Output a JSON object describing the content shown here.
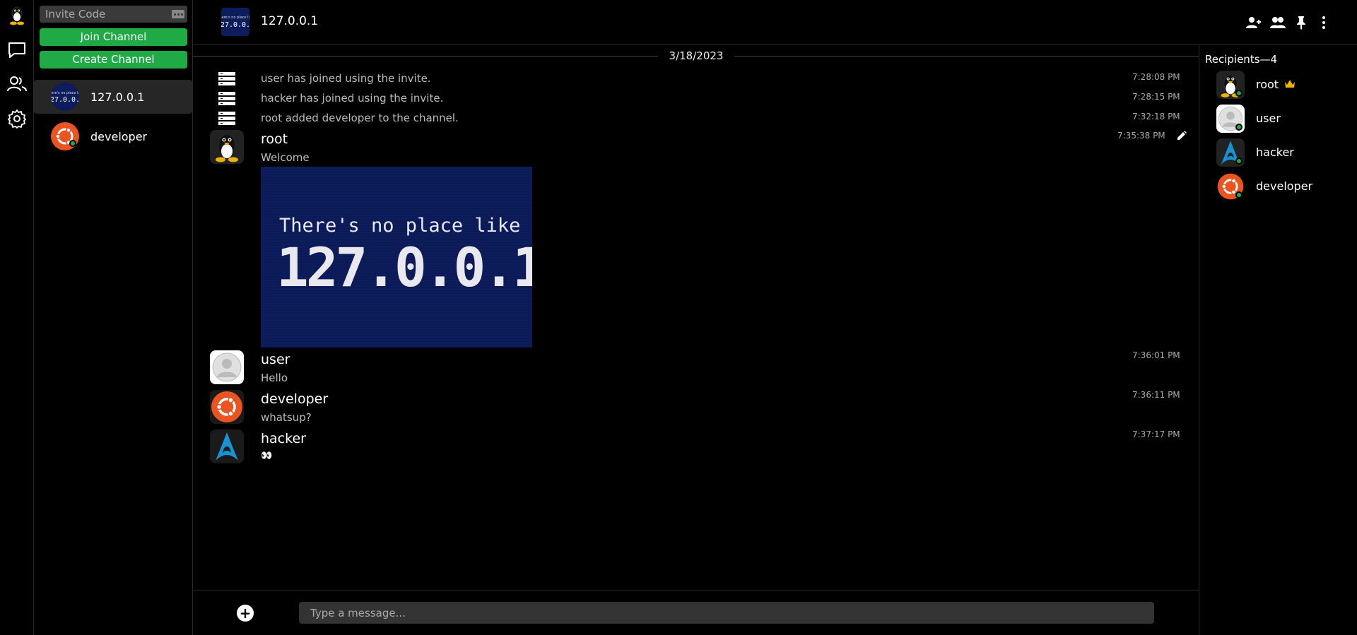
{
  "rail": {
    "logo": "tux-logo-icon",
    "items": [
      {
        "name": "chat-icon"
      },
      {
        "name": "friends-icon"
      },
      {
        "name": "settings-icon"
      }
    ]
  },
  "sidebar": {
    "invite_placeholder": "Invite Code",
    "join_label": "Join Channel",
    "create_label": "Create Channel",
    "channels": [
      {
        "label": "127.0.0.1",
        "active": true
      },
      {
        "label": "developer",
        "active": false
      }
    ]
  },
  "header": {
    "title": "127.0.0.1",
    "actions": [
      "add-user-icon",
      "members-icon",
      "pin-icon",
      "more-icon"
    ]
  },
  "channel_icon_text": {
    "line1": "There's no place like",
    "line2": "127.0.0.1"
  },
  "messages": {
    "date": "3/18/2023",
    "system": [
      {
        "text": "user has joined using the invite.",
        "time": "7:28:08 PM"
      },
      {
        "text": "hacker has joined using the invite.",
        "time": "7:28:15 PM"
      },
      {
        "text": "root added developer to the channel.",
        "time": "7:32:18 PM"
      }
    ],
    "posts": [
      {
        "author": "root",
        "text": "Welcome",
        "time": "7:35:38 PM"
      },
      {
        "author": "user",
        "text": "Hello",
        "time": "7:36:01 PM"
      },
      {
        "author": "developer",
        "text": "whatsup?",
        "time": "7:36:11 PM"
      },
      {
        "author": "hacker",
        "text": "👀",
        "time": "7:37:17 PM"
      }
    ]
  },
  "composer": {
    "placeholder": "Type a message..."
  },
  "recipients": {
    "title": "Recipients—4",
    "members": [
      {
        "name": "root",
        "owner": true
      },
      {
        "name": "user",
        "owner": false
      },
      {
        "name": "hacker",
        "owner": false
      },
      {
        "name": "developer",
        "owner": false
      }
    ]
  },
  "colors": {
    "accent_green": "#1faa46",
    "background": "#000000",
    "image_blue": "#0d1c5c",
    "ubuntu_orange": "#e95420",
    "arch_blue": "#1793d1",
    "crown_gold": "#f0b400"
  }
}
